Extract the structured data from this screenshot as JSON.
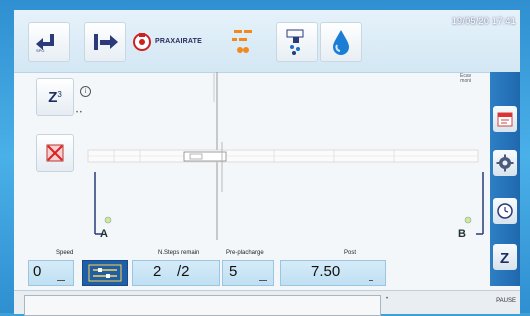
{
  "datetime": "19/05/20 17:41",
  "toolbar": {
    "buttons": [
      {
        "name": "back",
        "icon": "return-arrow-icon"
      },
      {
        "name": "exit",
        "icon": "exit-arrow-icon"
      },
      {
        "name": "brand",
        "icon": "brand-logo"
      },
      {
        "name": "pressure",
        "icon": "pressure-icon"
      },
      {
        "name": "dosing",
        "icon": "dosing-icon"
      },
      {
        "name": "water",
        "icon": "water-drop-icon"
      }
    ],
    "logo_text": "PRAXAIRATE"
  },
  "side": {
    "z_label": "Z",
    "z_sub": "3",
    "dots": "• •",
    "info": "i"
  },
  "markers": {
    "a": "A",
    "b": "B",
    "right_small": "Ecav\nmoni"
  },
  "bottom": {
    "speed_label": "Speed",
    "speed_value": "0",
    "steps_label": "N.Steps remain",
    "steps_value": "2",
    "steps_total": "/2",
    "preplace_label": "Pre-placharge",
    "preplace_value": "5",
    "post_label": "Post",
    "post_value": "7.50"
  },
  "footer": {
    "pause": "PAUSE",
    "tick": "•"
  },
  "right_buttons": [
    "calendar-icon",
    "gear-icon",
    "clock-icon",
    "z-icon"
  ],
  "colors": {
    "frame": "#3fa0d8",
    "accent": "#1f68ae",
    "field": "#cfe7f6"
  }
}
